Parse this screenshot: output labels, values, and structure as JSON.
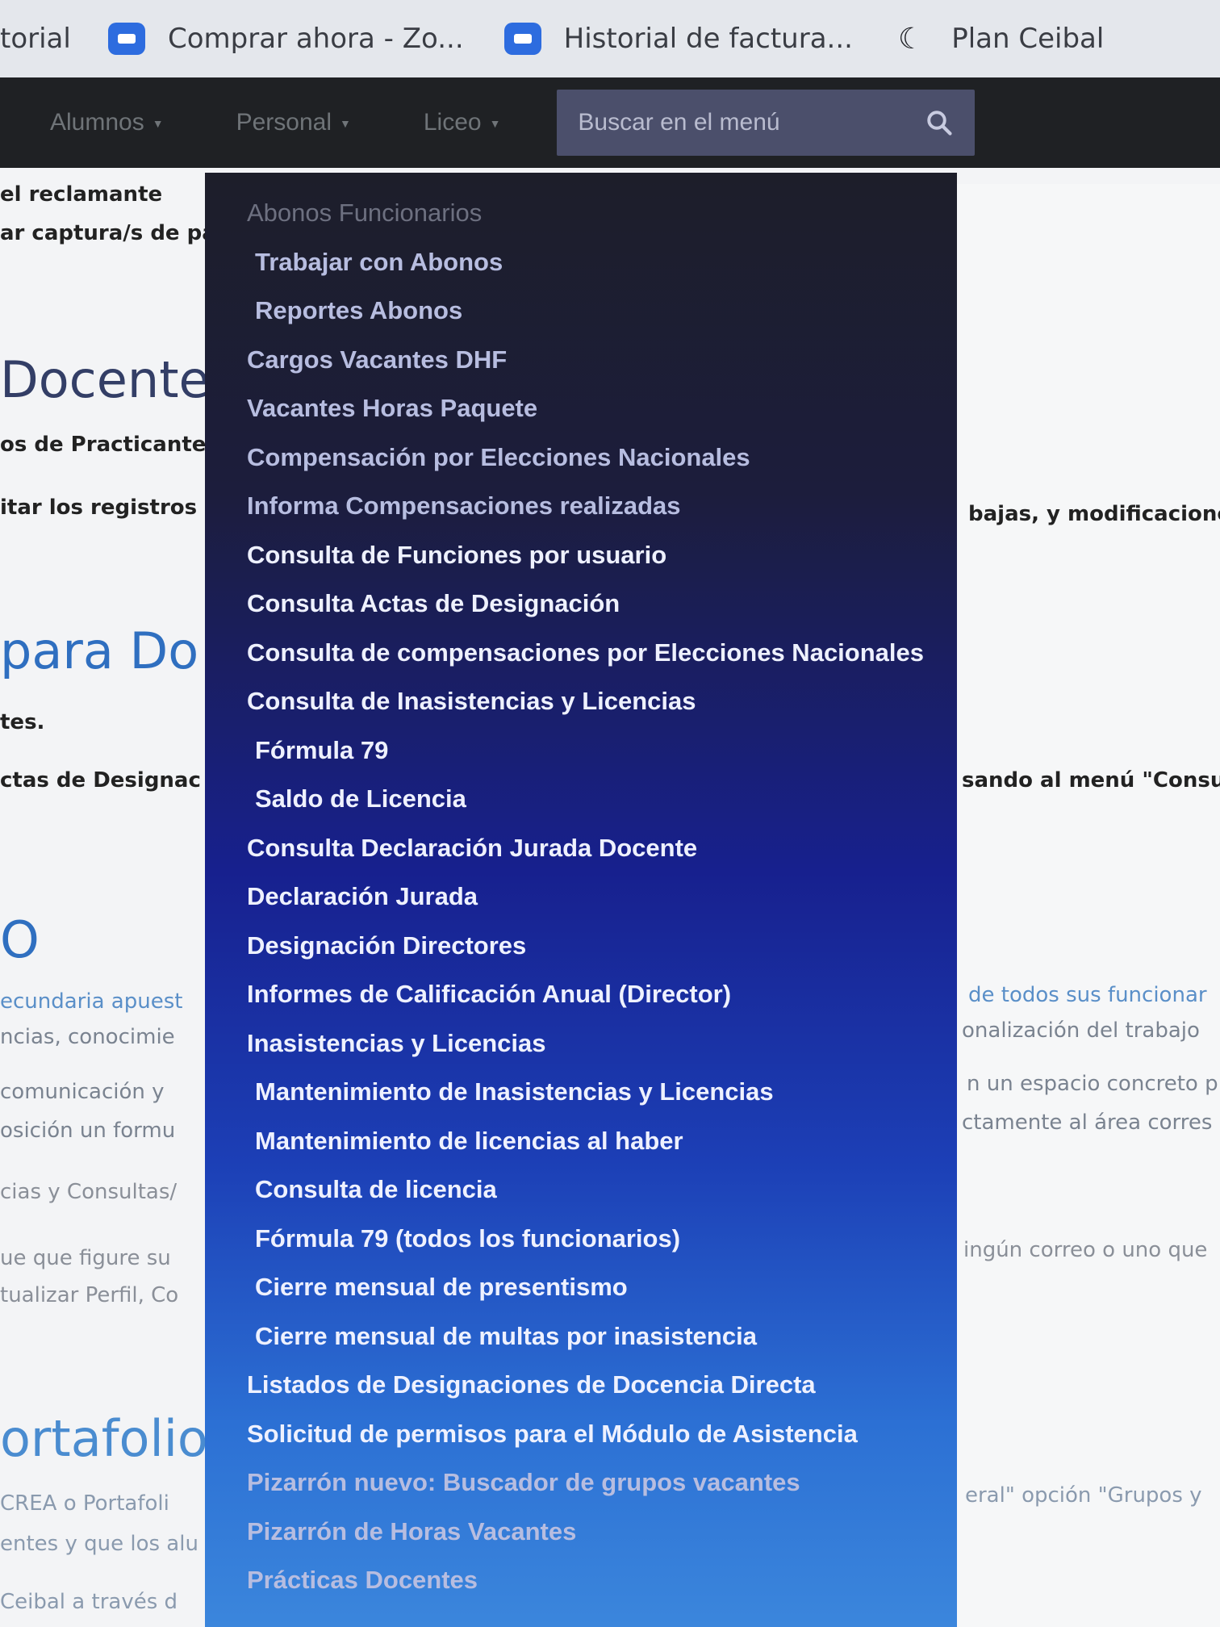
{
  "bookmarks": [
    {
      "label": "torial",
      "icon": "none"
    },
    {
      "label": "Comprar ahora - Zo...",
      "icon": "zoom-icon"
    },
    {
      "label": "Historial de factura...",
      "icon": "zoom-icon"
    },
    {
      "label": "Plan Ceibal",
      "icon": "moon-icon"
    }
  ],
  "nav": {
    "items": [
      "Alumnos",
      "Personal",
      "Liceo"
    ],
    "search_placeholder": "Buscar en el menú"
  },
  "background": {
    "lines": [
      "el reclamante",
      "ar captura/s de pa",
      "Docente",
      "os de Practicante",
      "itar los registros",
      "bajas, y modificaciones",
      "para Do",
      "tes.",
      "ctas de Designac",
      "sando al menú \"Consul",
      "O",
      "ecundaria apuest",
      "de todos sus funcionar",
      "ncias, conocimie",
      "onalización del trabajo",
      "comunicación y",
      "n un espacio concreto p",
      "osición un formu",
      "ctamente al área corres",
      "cias y Consultas/",
      "ue que figure su",
      "ingún correo o uno que",
      "tualizar Perfil, Co",
      "ortafolio",
      "CREA o Portafoli",
      "eral\" opción \"Grupos y",
      "entes y que los alu",
      "Ceibal a través d"
    ]
  },
  "menu": {
    "items": [
      {
        "label": "Abonos Funcionarios"
      },
      {
        "label": "Trabajar con Abonos"
      },
      {
        "label": "Reportes Abonos"
      },
      {
        "label": "Cargos Vacantes DHF"
      },
      {
        "label": "Vacantes Horas Paquete"
      },
      {
        "label": "Compensación por Elecciones Nacionales"
      },
      {
        "label": "Informa Compensaciones realizadas"
      },
      {
        "label": "Consulta de Funciones por usuario"
      },
      {
        "label": "Consulta Actas de Designación"
      },
      {
        "label": "Consulta de compensaciones por Elecciones Nacionales"
      },
      {
        "label": "Consulta de Inasistencias y Licencias"
      },
      {
        "label": "Fórmula 79"
      },
      {
        "label": "Saldo de Licencia"
      },
      {
        "label": "Consulta Declaración Jurada Docente"
      },
      {
        "label": "Declaración Jurada"
      },
      {
        "label": "Designación Directores"
      },
      {
        "label": "Informes de Calificación Anual (Director)"
      },
      {
        "label": "Inasistencias y Licencias"
      },
      {
        "label": "Mantenimiento de Inasistencias y Licencias"
      },
      {
        "label": "Mantenimiento de licencias al haber"
      },
      {
        "label": "Consulta de licencia"
      },
      {
        "label": "Fórmula 79 (todos los funcionarios)"
      },
      {
        "label": "Cierre mensual de presentismo"
      },
      {
        "label": "Cierre mensual de multas por inasistencia"
      },
      {
        "label": "Listados de Designaciones de Docencia Directa"
      },
      {
        "label": "Solicitud de permisos para el Módulo de Asistencia"
      },
      {
        "label": "Pizarrón nuevo: Buscador de grupos vacantes"
      },
      {
        "label": "Pizarrón de Horas Vacantes"
      },
      {
        "label": "Prácticas Docentes"
      }
    ]
  }
}
